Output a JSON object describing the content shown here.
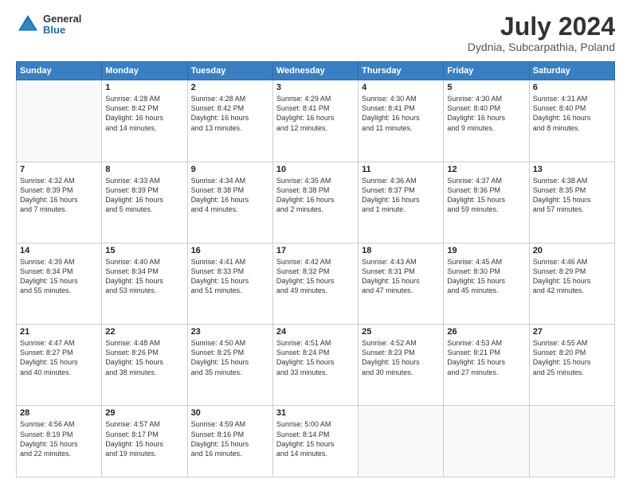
{
  "header": {
    "logo_general": "General",
    "logo_blue": "Blue",
    "month_year": "July 2024",
    "location": "Dydnia, Subcarpathia, Poland"
  },
  "weekdays": [
    "Sunday",
    "Monday",
    "Tuesday",
    "Wednesday",
    "Thursday",
    "Friday",
    "Saturday"
  ],
  "weeks": [
    [
      {
        "day": "",
        "info": ""
      },
      {
        "day": "1",
        "info": "Sunrise: 4:28 AM\nSunset: 8:42 PM\nDaylight: 16 hours\nand 14 minutes."
      },
      {
        "day": "2",
        "info": "Sunrise: 4:28 AM\nSunset: 8:42 PM\nDaylight: 16 hours\nand 13 minutes."
      },
      {
        "day": "3",
        "info": "Sunrise: 4:29 AM\nSunset: 8:41 PM\nDaylight: 16 hours\nand 12 minutes."
      },
      {
        "day": "4",
        "info": "Sunrise: 4:30 AM\nSunset: 8:41 PM\nDaylight: 16 hours\nand 11 minutes."
      },
      {
        "day": "5",
        "info": "Sunrise: 4:30 AM\nSunset: 8:40 PM\nDaylight: 16 hours\nand 9 minutes."
      },
      {
        "day": "6",
        "info": "Sunrise: 4:31 AM\nSunset: 8:40 PM\nDaylight: 16 hours\nand 8 minutes."
      }
    ],
    [
      {
        "day": "7",
        "info": "Sunrise: 4:32 AM\nSunset: 8:39 PM\nDaylight: 16 hours\nand 7 minutes."
      },
      {
        "day": "8",
        "info": "Sunrise: 4:33 AM\nSunset: 8:39 PM\nDaylight: 16 hours\nand 5 minutes."
      },
      {
        "day": "9",
        "info": "Sunrise: 4:34 AM\nSunset: 8:38 PM\nDaylight: 16 hours\nand 4 minutes."
      },
      {
        "day": "10",
        "info": "Sunrise: 4:35 AM\nSunset: 8:38 PM\nDaylight: 16 hours\nand 2 minutes."
      },
      {
        "day": "11",
        "info": "Sunrise: 4:36 AM\nSunset: 8:37 PM\nDaylight: 16 hours\nand 1 minute."
      },
      {
        "day": "12",
        "info": "Sunrise: 4:37 AM\nSunset: 8:36 PM\nDaylight: 15 hours\nand 59 minutes."
      },
      {
        "day": "13",
        "info": "Sunrise: 4:38 AM\nSunset: 8:35 PM\nDaylight: 15 hours\nand 57 minutes."
      }
    ],
    [
      {
        "day": "14",
        "info": "Sunrise: 4:39 AM\nSunset: 8:34 PM\nDaylight: 15 hours\nand 55 minutes."
      },
      {
        "day": "15",
        "info": "Sunrise: 4:40 AM\nSunset: 8:34 PM\nDaylight: 15 hours\nand 53 minutes."
      },
      {
        "day": "16",
        "info": "Sunrise: 4:41 AM\nSunset: 8:33 PM\nDaylight: 15 hours\nand 51 minutes."
      },
      {
        "day": "17",
        "info": "Sunrise: 4:42 AM\nSunset: 8:32 PM\nDaylight: 15 hours\nand 49 minutes."
      },
      {
        "day": "18",
        "info": "Sunrise: 4:43 AM\nSunset: 8:31 PM\nDaylight: 15 hours\nand 47 minutes."
      },
      {
        "day": "19",
        "info": "Sunrise: 4:45 AM\nSunset: 8:30 PM\nDaylight: 15 hours\nand 45 minutes."
      },
      {
        "day": "20",
        "info": "Sunrise: 4:46 AM\nSunset: 8:29 PM\nDaylight: 15 hours\nand 42 minutes."
      }
    ],
    [
      {
        "day": "21",
        "info": "Sunrise: 4:47 AM\nSunset: 8:27 PM\nDaylight: 15 hours\nand 40 minutes."
      },
      {
        "day": "22",
        "info": "Sunrise: 4:48 AM\nSunset: 8:26 PM\nDaylight: 15 hours\nand 38 minutes."
      },
      {
        "day": "23",
        "info": "Sunrise: 4:50 AM\nSunset: 8:25 PM\nDaylight: 15 hours\nand 35 minutes."
      },
      {
        "day": "24",
        "info": "Sunrise: 4:51 AM\nSunset: 8:24 PM\nDaylight: 15 hours\nand 33 minutes."
      },
      {
        "day": "25",
        "info": "Sunrise: 4:52 AM\nSunset: 8:23 PM\nDaylight: 15 hours\nand 30 minutes."
      },
      {
        "day": "26",
        "info": "Sunrise: 4:53 AM\nSunset: 8:21 PM\nDaylight: 15 hours\nand 27 minutes."
      },
      {
        "day": "27",
        "info": "Sunrise: 4:55 AM\nSunset: 8:20 PM\nDaylight: 15 hours\nand 25 minutes."
      }
    ],
    [
      {
        "day": "28",
        "info": "Sunrise: 4:56 AM\nSunset: 8:19 PM\nDaylight: 15 hours\nand 22 minutes."
      },
      {
        "day": "29",
        "info": "Sunrise: 4:57 AM\nSunset: 8:17 PM\nDaylight: 15 hours\nand 19 minutes."
      },
      {
        "day": "30",
        "info": "Sunrise: 4:59 AM\nSunset: 8:16 PM\nDaylight: 15 hours\nand 16 minutes."
      },
      {
        "day": "31",
        "info": "Sunrise: 5:00 AM\nSunset: 8:14 PM\nDaylight: 15 hours\nand 14 minutes."
      },
      {
        "day": "",
        "info": ""
      },
      {
        "day": "",
        "info": ""
      },
      {
        "day": "",
        "info": ""
      }
    ]
  ]
}
